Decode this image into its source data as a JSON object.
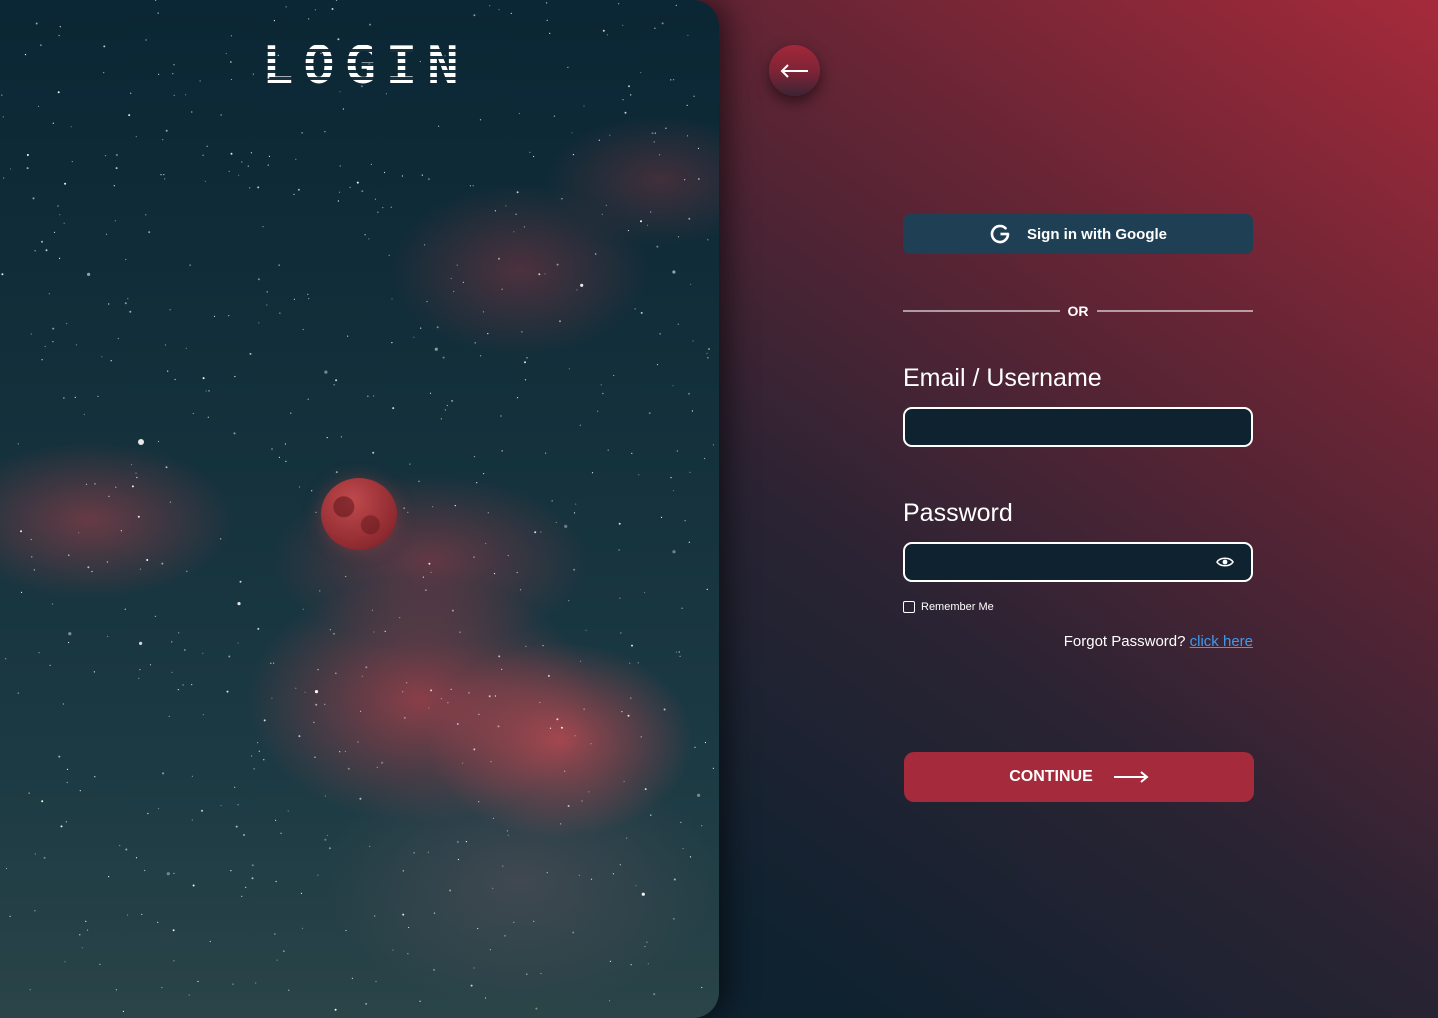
{
  "hero": {
    "title": "LOGIN"
  },
  "nav": {
    "back_icon": "arrow-left-icon"
  },
  "form": {
    "google_button_label": "Sign in with Google",
    "google_icon": "google-g-icon",
    "divider_text": "OR",
    "email_label": "Email / Username",
    "email_value": "",
    "password_label": "Password",
    "password_value": "",
    "password_toggle_icon": "eye-icon",
    "remember_label": "Remember Me",
    "remember_checked": false,
    "forgot_text": "Forgot Password? ",
    "forgot_link": "click here",
    "continue_label": "CONTINUE",
    "continue_icon": "arrow-right-icon"
  },
  "colors": {
    "accent": "#a52a3b",
    "google_button_bg": "#1f4054",
    "link": "#3d9bf0",
    "panel_dark": "#0d2230"
  }
}
